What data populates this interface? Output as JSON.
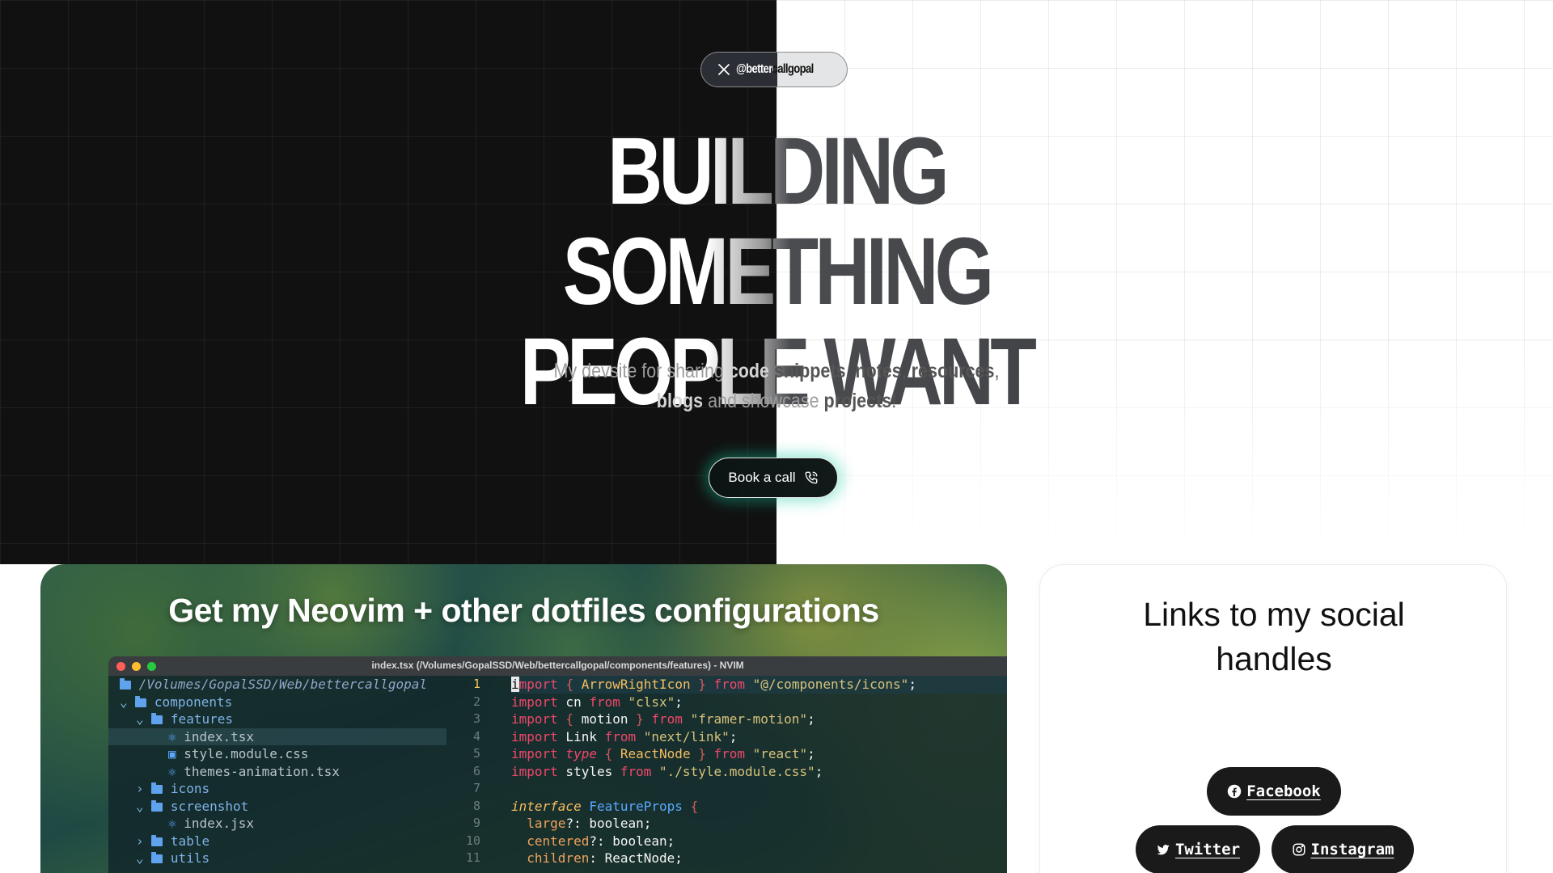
{
  "header": {
    "handle": "@bettercallgopal"
  },
  "hero": {
    "title_line1": "BUILDING SOMETHING",
    "title_line2": "PEOPLE WANT",
    "subtitle": {
      "lead": "My devsite for sharing",
      "code": "code",
      "snippets": "snippets",
      "comma1": ",",
      "notes": "notes",
      "comma2": ",",
      "resources": "resources",
      "comma3": ",",
      "blogs": "blogs",
      "and_show": "and showcase",
      "projects": "projects",
      "bang": "!"
    },
    "cta_label": "Book a call"
  },
  "dotfiles_card": {
    "title": "Get my Neovim + other dotfiles configurations",
    "window_title": "index.tsx (/Volumes/GopalSSD/Web/bettercallgopal/components/features) - NVIM",
    "tree": [
      {
        "label": "/Volumes/GopalSSD/Web/bettercallgopal",
        "kind": "root"
      },
      {
        "label": "components",
        "kind": "folder"
      },
      {
        "label": "features",
        "kind": "folder"
      },
      {
        "label": "index.tsx",
        "kind": "file-react"
      },
      {
        "label": "style.module.css",
        "kind": "file-css"
      },
      {
        "label": "themes-animation.tsx",
        "kind": "file-react"
      },
      {
        "label": "icons",
        "kind": "folder"
      },
      {
        "label": "screenshot",
        "kind": "folder"
      },
      {
        "label": "index.jsx",
        "kind": "file-react"
      },
      {
        "label": "table",
        "kind": "folder"
      },
      {
        "label": "utils",
        "kind": "folder"
      }
    ],
    "line_numbers": [
      "1",
      "2",
      "3",
      "4",
      "5",
      "6",
      "7",
      "8",
      "9",
      "10",
      "11"
    ],
    "code": {
      "l1": {
        "imp": "mport",
        "a": " { ",
        "b": "ArrowRightIcon",
        "c": " } ",
        "from": "from",
        "s": " \"@/components/icons\"",
        "e": ";"
      },
      "l2": {
        "imp": "import",
        "id": " cn ",
        "from": "from",
        "s": " \"clsx\"",
        "e": ";"
      },
      "l3": {
        "imp": "import",
        "a": " { ",
        "b": "motion",
        "c": " } ",
        "from": "from",
        "s": " \"framer-motion\"",
        "e": ";"
      },
      "l4": {
        "imp": "import",
        "id": " Link ",
        "from": "from",
        "s": " \"next/link\"",
        "e": ";"
      },
      "l5": {
        "imp": "import",
        "ty": " type",
        "a": " { ",
        "b": "ReactNode",
        "c": " } ",
        "from": "from",
        "s": " \"react\"",
        "e": ";"
      },
      "l6": {
        "imp": "import",
        "id": " styles ",
        "from": "from",
        "s": " \"./style.module.css\"",
        "e": ";"
      },
      "l8": {
        "kw": "interface",
        "name": " FeatureProps",
        "br": " {"
      },
      "l9": {
        "prop": "  large",
        "rest": "?: boolean;"
      },
      "l10": {
        "prop": "  centered",
        "rest": "?: boolean;"
      },
      "l11": {
        "prop": "  children",
        "rest": ": ReactNode;"
      }
    }
  },
  "social_card": {
    "title_line1": "Links to my social",
    "title_line2": "handles",
    "buttons": {
      "facebook": "Facebook",
      "twitter": "Twitter",
      "instagram": "Instagram"
    }
  },
  "icons": [
    "x-logo-icon",
    "phone-icon",
    "facebook-icon",
    "twitter-icon",
    "instagram-icon",
    "folder-icon",
    "react-file-icon",
    "css-file-icon"
  ],
  "colors": {
    "dark_bg": "#111111",
    "accent_glow": "#10c9a0"
  }
}
